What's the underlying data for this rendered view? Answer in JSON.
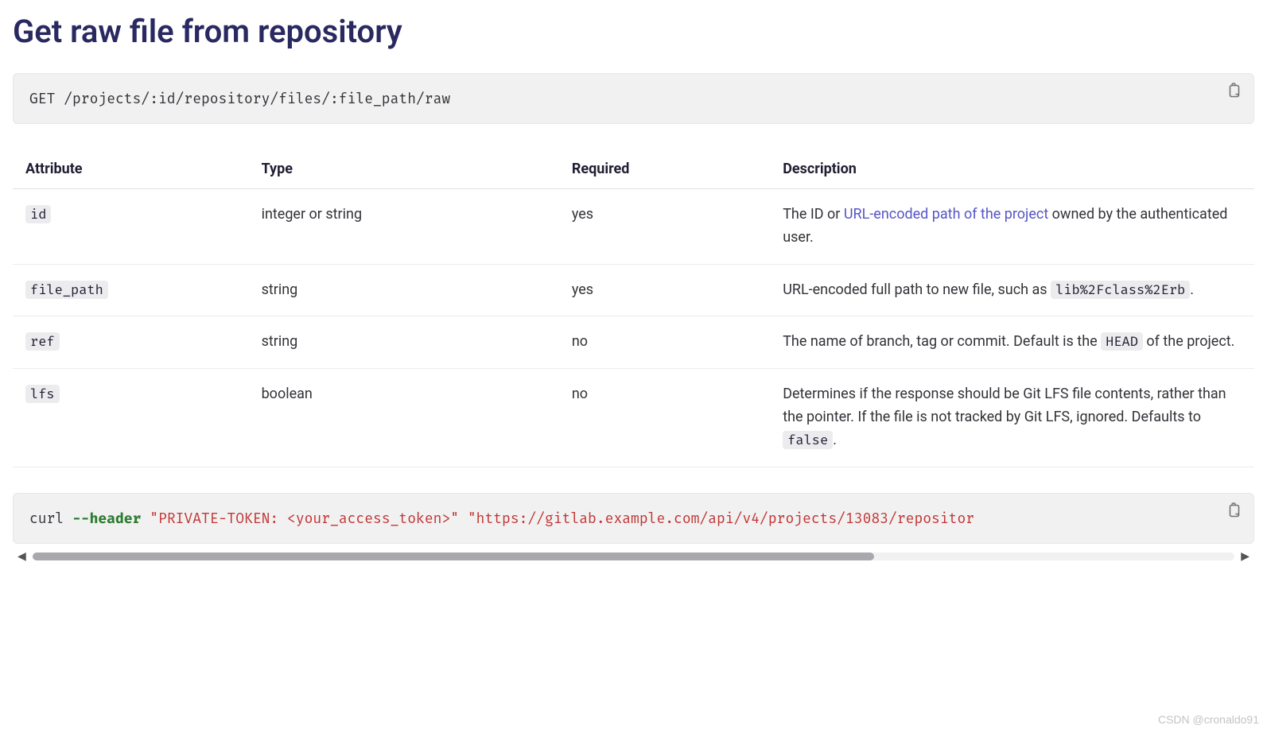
{
  "heading": "Get raw file from repository",
  "endpoint": "GET /projects/:id/repository/files/:file_path/raw",
  "table": {
    "headers": [
      "Attribute",
      "Type",
      "Required",
      "Description"
    ],
    "rows": [
      {
        "attr": "id",
        "type": "integer or string",
        "required": "yes",
        "desc_prefix": "The ID or ",
        "desc_link": "URL-encoded path of the project",
        "desc_suffix": " owned by the authenticated user."
      },
      {
        "attr": "file_path",
        "type": "string",
        "required": "yes",
        "desc_prefix": "URL-encoded full path to new file, such as ",
        "desc_code": "lib%2Fclass%2Erb",
        "desc_suffix": "."
      },
      {
        "attr": "ref",
        "type": "string",
        "required": "no",
        "desc_prefix": "The name of branch, tag or commit. Default is the ",
        "desc_code": "HEAD",
        "desc_suffix": " of the project."
      },
      {
        "attr": "lfs",
        "type": "boolean",
        "required": "no",
        "desc_prefix": "Determines if the response should be Git LFS file contents, rather than the pointer. If the file is not tracked by Git LFS, ignored. Defaults to ",
        "desc_code": "false",
        "desc_suffix": "."
      }
    ]
  },
  "curl": {
    "cmd": "curl ",
    "flag": "--header",
    "sp1": " ",
    "str1": "\"PRIVATE-TOKEN: <your_access_token>\"",
    "sp2": " ",
    "str2": "\"https://gitlab.example.com/api/v4/projects/13083/repositor"
  },
  "watermark": "CSDN @cronaldo91"
}
